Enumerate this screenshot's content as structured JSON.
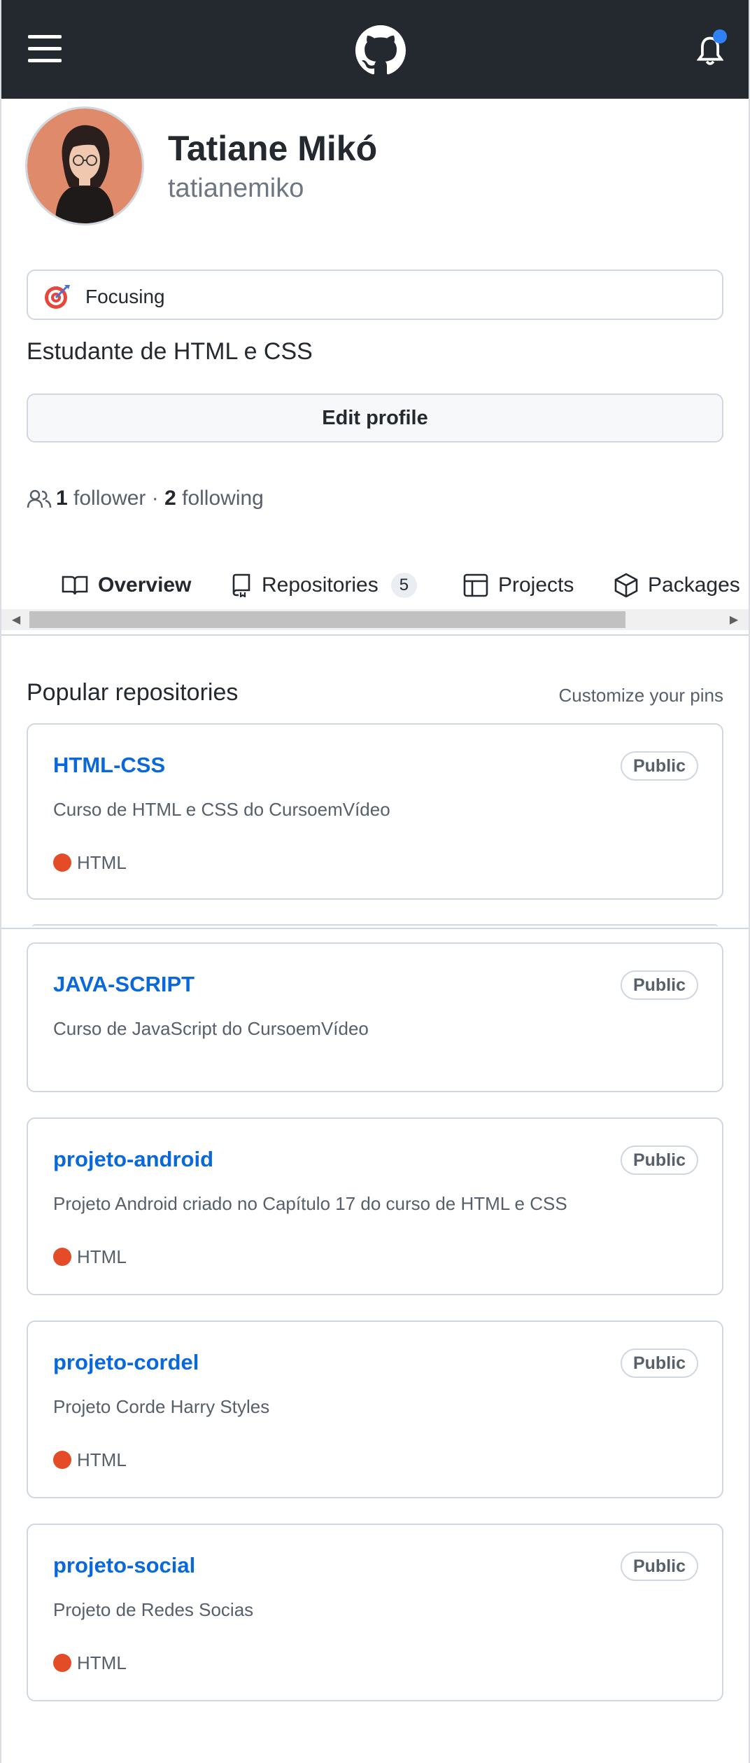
{
  "header": {
    "menu_icon": "hamburger-menu-icon",
    "logo_icon": "github-logo-icon",
    "notifications_icon": "bell-icon",
    "notification_dot_color": "#2f81f7"
  },
  "profile": {
    "full_name": "Tatiane Mikó",
    "username": "tatianemiko",
    "status": "Focusing",
    "bio": "Estudante de HTML e CSS",
    "edit_button": "Edit profile",
    "followers_count": "1",
    "followers_label": "follower",
    "separator": "·",
    "following_count": "2",
    "following_label": "following"
  },
  "tabs": [
    {
      "label": "Overview",
      "icon": "book-icon",
      "active": true
    },
    {
      "label": "Repositories",
      "icon": "repo-icon",
      "count": "5"
    },
    {
      "label": "Projects",
      "icon": "table-icon"
    },
    {
      "label": "Packages",
      "icon": "package-icon"
    }
  ],
  "popular": {
    "title": "Popular repositories",
    "customize": "Customize your pins",
    "repos": [
      {
        "name": "HTML-CSS",
        "visibility": "Public",
        "description": "Curso de HTML e CSS do CursoemVídeo",
        "language": "HTML"
      },
      {
        "name": "JAVA-SCRIPT",
        "visibility": "Public",
        "description": "Curso de JavaScript do CursoemVídeo",
        "language": ""
      },
      {
        "name": "projeto-android",
        "visibility": "Public",
        "description": "Projeto Android criado no Capítulo 17 do curso de HTML e CSS",
        "language": "HTML"
      },
      {
        "name": "projeto-cordel",
        "visibility": "Public",
        "description": "Projeto Corde Harry Styles",
        "language": "HTML"
      },
      {
        "name": "projeto-social",
        "visibility": "Public",
        "description": "Projeto de Redes Socias",
        "language": "HTML"
      }
    ]
  },
  "colors": {
    "header_bg": "#24292f",
    "link": "#0969da",
    "html_language": "#e34c26"
  }
}
